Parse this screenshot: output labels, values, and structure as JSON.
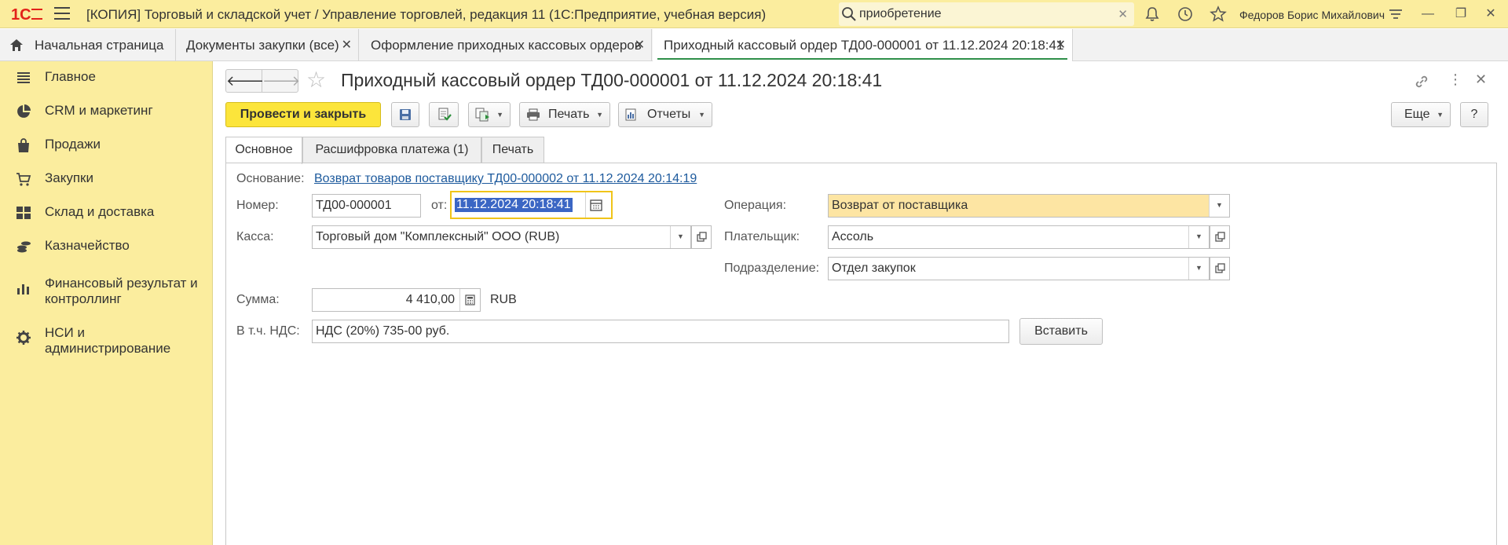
{
  "titlebar": {
    "app_title": "[КОПИЯ] Торговый и складской учет / Управление торговлей, редакция 11  (1С:Предприятие, учебная версия)",
    "search_value": "приобретение",
    "user": "Федоров Борис Михайлович",
    "logo_text": "1С",
    "brand_color": "#e2231a"
  },
  "tabs": [
    {
      "label": "Начальная страница"
    },
    {
      "label": "Документы закупки (все)"
    },
    {
      "label": "Оформление приходных кассовых ордеров"
    },
    {
      "label": "Приходный кассовый ордер ТД00-000001 от 11.12.2024 20:18:41",
      "active": true
    }
  ],
  "sidebar": {
    "items": [
      {
        "label": "Главное",
        "icon": "menu-lines-icon"
      },
      {
        "label": "CRM и маркетинг",
        "icon": "pie-chart-icon"
      },
      {
        "label": "Продажи",
        "icon": "shopping-bag-icon"
      },
      {
        "label": "Закупки",
        "icon": "cart-icon"
      },
      {
        "label": "Склад и доставка",
        "icon": "warehouse-grid-icon"
      },
      {
        "label": "Казначейство",
        "icon": "coins-icon"
      },
      {
        "label": "Финансовый результат и контроллинг",
        "icon": "bar-chart-icon"
      },
      {
        "label": "НСИ и администрирование",
        "icon": "gear-icon"
      }
    ]
  },
  "document": {
    "title": "Приходный кассовый ордер ТД00-000001 от 11.12.2024 20:18:41"
  },
  "toolbar": {
    "post_and_close": "Провести и закрыть",
    "print": "Печать",
    "reports": "Отчеты",
    "more": "Еще",
    "help": "?"
  },
  "form_tabs": [
    {
      "label": "Основное",
      "active": true
    },
    {
      "label": "Расшифровка платежа (1)"
    },
    {
      "label": "Печать"
    }
  ],
  "form": {
    "basis_label": "Основание:",
    "basis_link": "Возврат товаров поставщику ТД00-000002 от 11.12.2024 20:14:19",
    "number_label": "Номер:",
    "number_value": "ТД00-000001",
    "date_label": "от:",
    "date_value": "11.12.2024 20:18:41",
    "cash_label": "Касса:",
    "cash_value": "Торговый дом \"Комплексный\" ООО (RUB)",
    "operation_label": "Операция:",
    "operation_value": "Возврат от поставщика",
    "payer_label": "Плательщик:",
    "payer_value": "Ассоль",
    "division_label": "Подразделение:",
    "division_value": "Отдел закупок",
    "sum_label": "Сумма:",
    "sum_value": "4 410,00",
    "currency": "RUB",
    "vat_label": "В т.ч. НДС:",
    "vat_value": "НДС (20%) 735-00 руб.",
    "insert_button": "Вставить"
  }
}
